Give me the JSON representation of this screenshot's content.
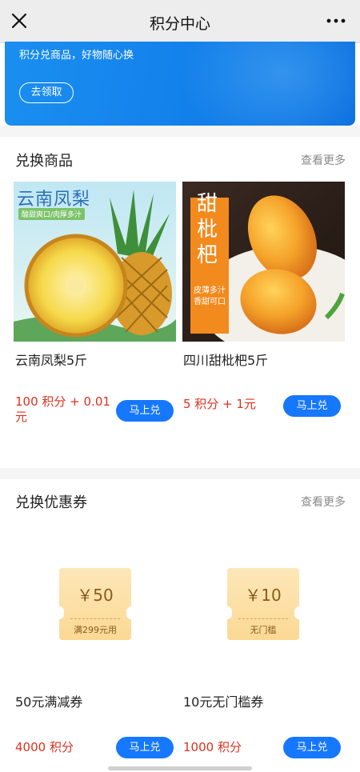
{
  "header": {
    "title": "积分中心",
    "close_icon": "close-icon",
    "more_icon": "more-dots-icon"
  },
  "banner": {
    "subtitle": "积分兑商品，好物随心换",
    "button_label": "去领取",
    "color": "#1483ec"
  },
  "products_section": {
    "title": "兑换商品",
    "more_label": "查看更多",
    "items": [
      {
        "name": "云南凤梨5斤",
        "price": "100 积分 + 0.01 元",
        "button": "马上兑",
        "image_title": "云南凤梨",
        "image_tag": "酸甜爽口/肉厚多汁"
      },
      {
        "name": "四川甜枇杷5斤",
        "price": "5 积分 + 1元",
        "button": "马上兑",
        "image_title": "甜枇杷",
        "image_tags": [
          "皮薄多汁",
          "香甜可口"
        ]
      }
    ]
  },
  "coupons_section": {
    "title": "兑换优惠券",
    "more_label": "查看更多",
    "items": [
      {
        "amount": "￥50",
        "condition": "满299元用",
        "name": "50元满减券",
        "price": "4000 积分",
        "button": "马上兑"
      },
      {
        "amount": "￥10",
        "condition": "无门槛",
        "name": "10元无门槛券",
        "price": "1000 积分",
        "button": "马上兑"
      }
    ]
  },
  "colors": {
    "accent": "#1677ff",
    "price": "#e0301e",
    "coupon": "#fbd994"
  }
}
